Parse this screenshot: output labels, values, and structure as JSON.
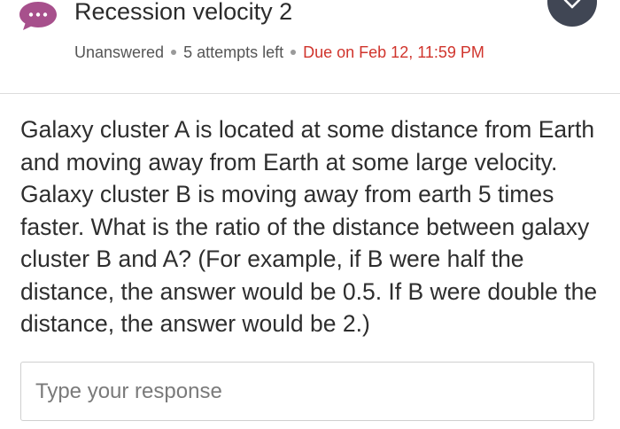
{
  "header": {
    "title": "Recession velocity 2",
    "status": "Unanswered",
    "attempts": "5 attempts left",
    "due": "Due on Feb 12, 11:59 PM",
    "icon": "chat-bubble-icon",
    "close_icon": "close-icon"
  },
  "question": {
    "text": "Galaxy cluster A is located at some distance from Earth and moving away from Earth at some large velocity. Galaxy cluster B is moving away from earth 5 times faster. What is the ratio of the distance between galaxy cluster B and A? (For example, if B were half the distance, the answer would be 0.5. If B were double the distance, the answer would be 2.)"
  },
  "response": {
    "placeholder": "Type your response",
    "value": ""
  },
  "colors": {
    "chat_icon": "#a7508c",
    "due_text": "#d0342c",
    "close_button": "#404654"
  }
}
